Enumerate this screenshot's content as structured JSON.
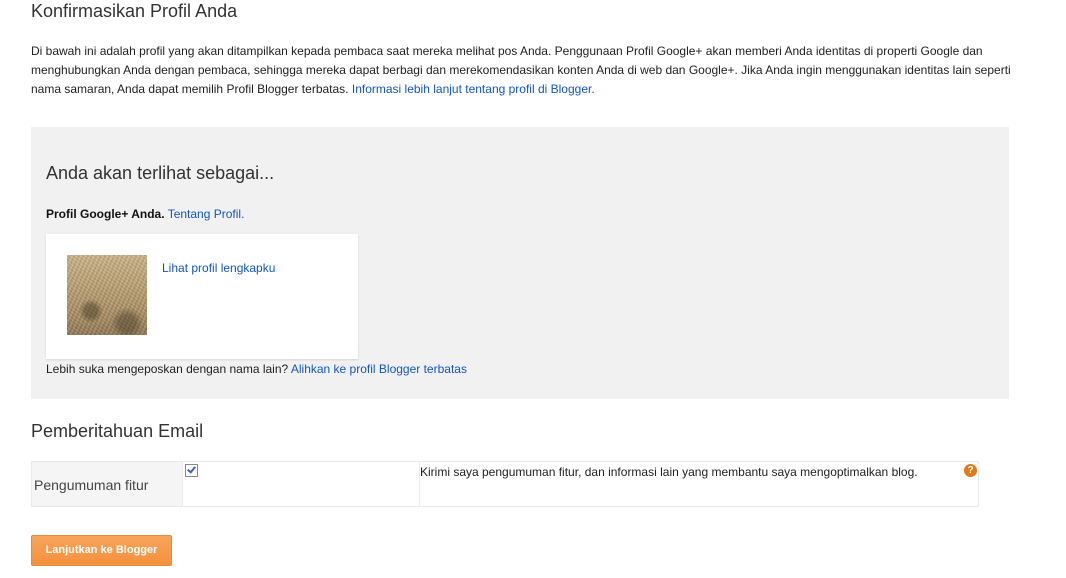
{
  "heading": "Konfirmasikan Profil Anda",
  "intro": {
    "text": "Di bawah ini adalah profil yang akan ditampilkan kepada pembaca saat mereka melihat pos Anda. Penggunaan Profil Google+ akan memberi Anda identitas di properti Google dan menghubungkan Anda dengan pembaca, sehingga mereka dapat berbagi dan merekomendasikan konten Anda di web dan Google+. Jika Anda ingin menggunakan identitas lain seperti nama samaran, Anda dapat memilih Profil Blogger terbatas.",
    "link": "Informasi lebih lanjut tentang profil di Blogger."
  },
  "preview": {
    "title": "Anda akan terlihat sebagai...",
    "profile_label": "Profil Google+ Anda.",
    "profile_link": "Tentang Profil.",
    "card_link": "Lihat profil lengkapku",
    "alt_text": "Lebih suka mengeposkan dengan nama lain?",
    "alt_link": "Alihkan ke profil Blogger terbatas"
  },
  "email": {
    "title": "Pemberitahuan Email",
    "row_label": "Pengumuman fitur",
    "checkbox_checked": true,
    "description": "Kirimi saya pengumuman fitur, dan informasi lain yang membantu saya mengoptimalkan blog.",
    "help_icon": "?"
  },
  "continue_button": "Lanjutkan ke Blogger",
  "colors": {
    "link": "#1155cc",
    "panel_bg": "#f1f1f1",
    "button": "#f4913c",
    "help_icon": "#e77817"
  }
}
